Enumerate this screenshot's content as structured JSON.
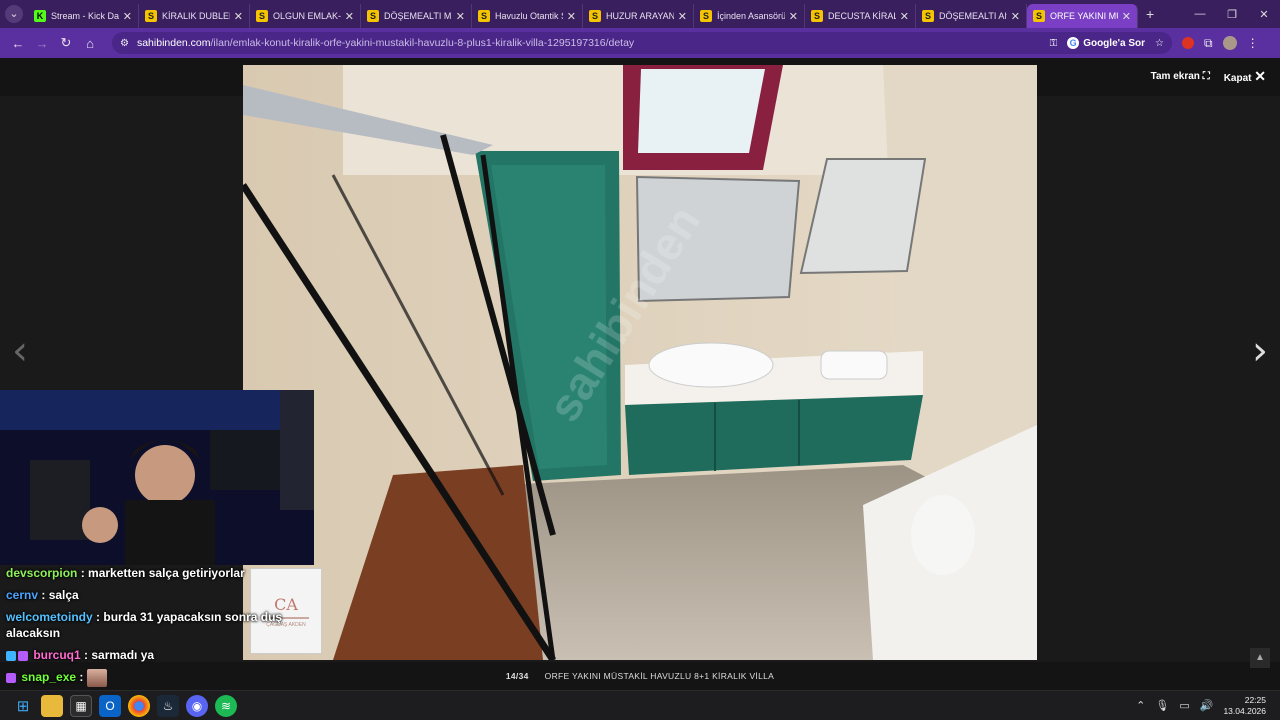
{
  "browser": {
    "tabs": [
      {
        "label": "Stream - Kick Das",
        "favicon": "K",
        "active": false
      },
      {
        "label": "KİRALIK DUBLEKS",
        "favicon": "S",
        "active": false
      },
      {
        "label": "OLGUN EMLAK-M",
        "favicon": "S",
        "active": false
      },
      {
        "label": "DÖŞEMEALTI MÜ",
        "favicon": "S",
        "active": false
      },
      {
        "label": "Havuzlu Otantik S",
        "favicon": "S",
        "active": false
      },
      {
        "label": "HUZUR ARAYANL",
        "favicon": "S",
        "active": false
      },
      {
        "label": "İçinden Asansörü",
        "favicon": "S",
        "active": false
      },
      {
        "label": "DECUSTA KİRALIK",
        "favicon": "S",
        "active": false
      },
      {
        "label": "DÖŞEMEALTI Alte",
        "favicon": "S",
        "active": false
      },
      {
        "label": "ORFE YAKINI MÜ",
        "favicon": "S",
        "active": true
      }
    ],
    "url_host": "sahibinden.com",
    "url_path": "/ilan/emlak-konut-kiralik-orfe-yakini-mustakil-havuzlu-8-plus1-kiralik-villa-1295197316/detay",
    "google_sor": "Google'a Sor"
  },
  "viewer": {
    "fullscreen_label": "Tam ekran",
    "close_label": "Kapat",
    "counter": "14/34",
    "caption": "ORFE YAKINI MÜSTAKİL HAVUZLU 8+1 KİRALIK VİLLA",
    "watermark": "sahibinden",
    "photo_id": "1295197316"
  },
  "chat": [
    {
      "user": "devscorpion",
      "message": "marketten salça getiriyorlar",
      "color": "green"
    },
    {
      "user": "cernv",
      "message": "salça",
      "color": "blue"
    },
    {
      "user": "welcometoindy",
      "message": "burda 31 yapacaksın sonra duş alacaksın",
      "color": "cyan"
    },
    {
      "user": "burcuq1",
      "message": "sarmadı ya",
      "color": "pink"
    },
    {
      "user": "snap_exe",
      "message": "",
      "color": "green2"
    }
  ],
  "logo_card": {
    "monogram": "CA",
    "text": "ÇAĞDAŞ AKDEN"
  },
  "taskbar": {
    "time": "22:25",
    "date": "13.04.2026"
  }
}
